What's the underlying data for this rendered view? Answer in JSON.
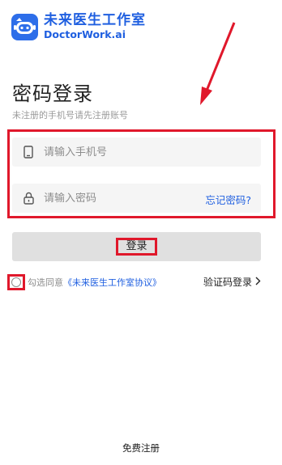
{
  "brand": {
    "name_cn": "未来医生工作室",
    "name_en": "DoctorWork.ai",
    "logo_icon": "robot-logo-icon",
    "color": "#1f5fe0"
  },
  "header": {
    "title": "密码登录",
    "subtitle": "未注册的手机号请先注册账号"
  },
  "form": {
    "phone": {
      "placeholder": "请输入手机号",
      "icon": "phone-icon"
    },
    "password": {
      "placeholder": "请输入密码",
      "icon": "lock-icon",
      "forgot_label": "忘记密码?"
    },
    "login_label": "登录"
  },
  "agreement": {
    "prefix": "勾选同意",
    "link": "《未来医生工作室协议》",
    "checked": false
  },
  "sms_login": {
    "label": "验证码登录",
    "icon": "chevron-right-icon"
  },
  "footer": {
    "register_label": "免费注册"
  },
  "colors": {
    "accent": "#1f5fe0",
    "annotation": "#e0182b"
  }
}
